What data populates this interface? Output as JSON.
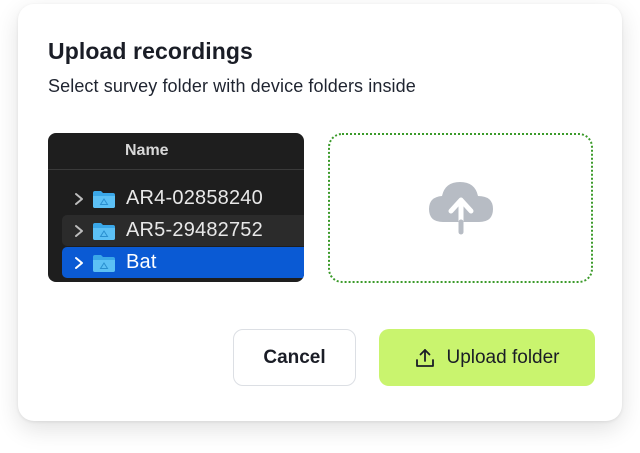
{
  "dialog": {
    "title": "Upload recordings",
    "subtitle": "Select survey folder with device folders inside"
  },
  "finder": {
    "column_header": "Name",
    "rows": [
      {
        "label": "AR4-02858240",
        "icon": "folder-icon",
        "selected": false
      },
      {
        "label": "AR5-29482752",
        "icon": "folder-icon",
        "selected": false
      },
      {
        "label": "Bat",
        "icon": "folder-icon",
        "selected": true
      }
    ]
  },
  "dropzone": {
    "icon": "cloud-upload-icon"
  },
  "buttons": {
    "cancel_label": "Cancel",
    "upload_label": "Upload folder",
    "upload_icon": "upload-icon"
  },
  "colors": {
    "accent": "#c9f46e",
    "dropzone_border": "#3b9a2a",
    "selection": "#0a5ad4",
    "finder_bg": "#1e1e1e"
  }
}
